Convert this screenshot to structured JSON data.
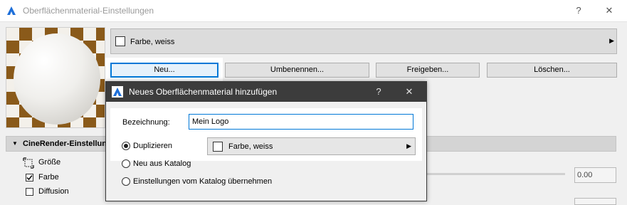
{
  "window": {
    "title": "Oberflächenmaterial-Einstellungen",
    "help_label": "?",
    "close_label": "✕"
  },
  "material_selector": {
    "value": "Farbe, weiss",
    "arrow": "▶"
  },
  "buttons": {
    "new": "Neu...",
    "rename": "Umbenennen...",
    "share": "Freigeben...",
    "delete": "Löschen..."
  },
  "cinerender": {
    "header": "CineRender-Einstellung",
    "caret": "▼",
    "items": [
      {
        "label": "Größe",
        "checked": false
      },
      {
        "label": "Farbe",
        "checked": true
      },
      {
        "label": "Diffusion",
        "checked": false
      }
    ],
    "value": "0.00"
  },
  "dialog": {
    "title": "Neues Oberflächenmaterial hinzufügen",
    "help_label": "?",
    "close_label": "✕",
    "name_label": "Bezeichnung:",
    "name_value": "Mein Logo",
    "options": [
      {
        "label": "Duplizieren",
        "selected": true
      },
      {
        "label": "Neu aus Katalog",
        "selected": false
      },
      {
        "label": "Einstellungen vom Katalog übernehmen",
        "selected": false
      }
    ],
    "duplicate_source": "Farbe, weiss",
    "dropdown_arrow": "▶"
  },
  "colors": {
    "accent": "#0078d7",
    "dialog_titlebar": "#3c3c3c",
    "checker_dark": "#8a5a1a",
    "checker_light": "#f3f0ea"
  }
}
